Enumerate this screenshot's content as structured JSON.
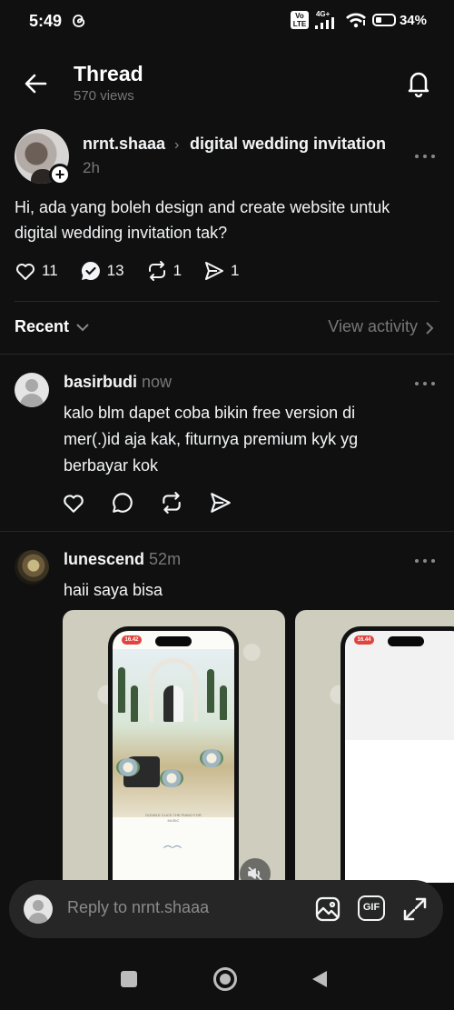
{
  "status_bar": {
    "time": "5:49",
    "volte": "Vo LTE",
    "network": "4G+",
    "battery": "34%"
  },
  "header": {
    "title": "Thread",
    "views": "570 views"
  },
  "post": {
    "username": "nrnt.shaaa",
    "topic": "digital wedding invitation",
    "time": "2h",
    "body": "Hi, ada yang boleh design and create website untuk digital wedding invitation tak?",
    "likes": "11",
    "comments": "13",
    "reposts": "1",
    "shares": "1"
  },
  "sort": {
    "label": "Recent",
    "view_activity": "View activity"
  },
  "replies": [
    {
      "username": "basirbudi",
      "time": "now",
      "body": "kalo blm dapet coba bikin free version di mer(.)id aja kak, fiturnya premium kyk yg berbayar kok"
    },
    {
      "username": "lunescend",
      "time": "52m",
      "body": "haii saya bisa"
    }
  ],
  "carousel": {
    "phone1_rec": "16.42",
    "phone2_rec": "16.44"
  },
  "composer": {
    "placeholder": "Reply to nrnt.shaaa",
    "gif_label": "GIF"
  },
  "icons": {
    "back": "arrow-left-icon",
    "bell": "bell-icon",
    "like": "heart-icon",
    "comment": "comment-icon",
    "repost": "repost-icon",
    "share": "send-icon",
    "image": "image-icon",
    "expand": "expand-icon",
    "mute": "mute-icon"
  }
}
